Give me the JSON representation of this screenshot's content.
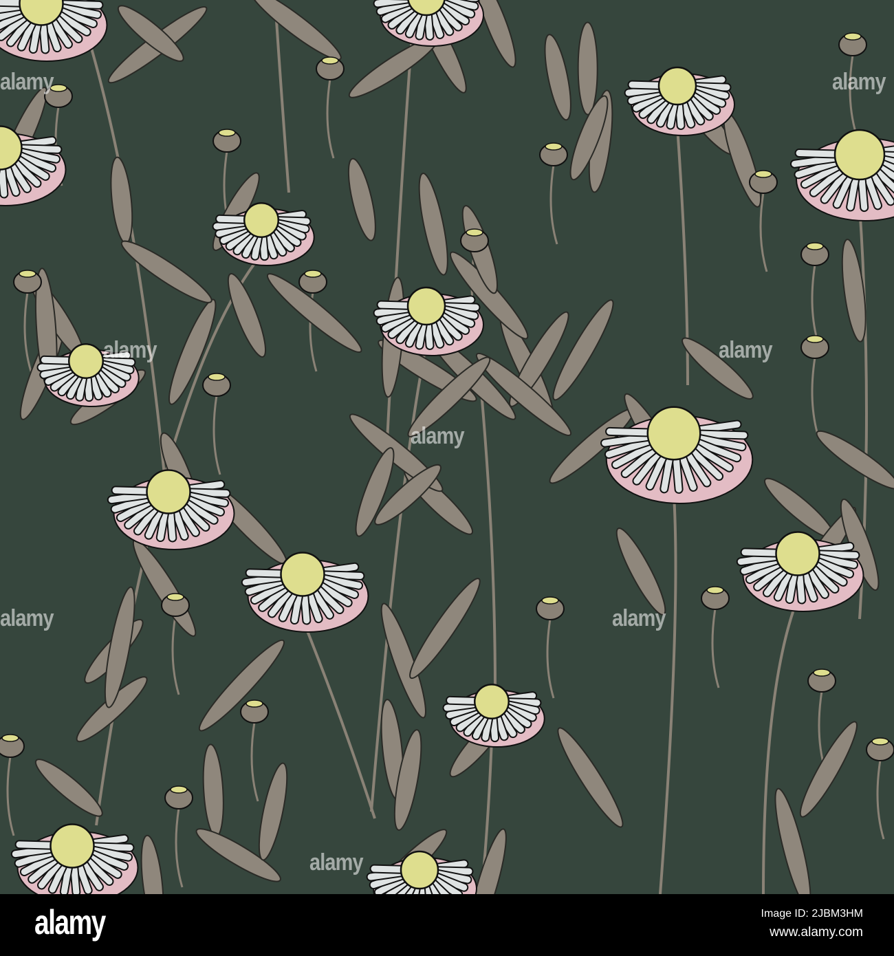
{
  "watermark": "alamy",
  "footer": {
    "logo": "alamy",
    "image_id": "Image ID: 2JBM3HM",
    "website": "www.alamy.com"
  },
  "colors": {
    "background": "#36463d",
    "leaf": "#8f877c",
    "petal": "#dfe3e3",
    "petal_shadow": "#e3bcc4",
    "center": "#dede8e",
    "outline": "#111111"
  }
}
